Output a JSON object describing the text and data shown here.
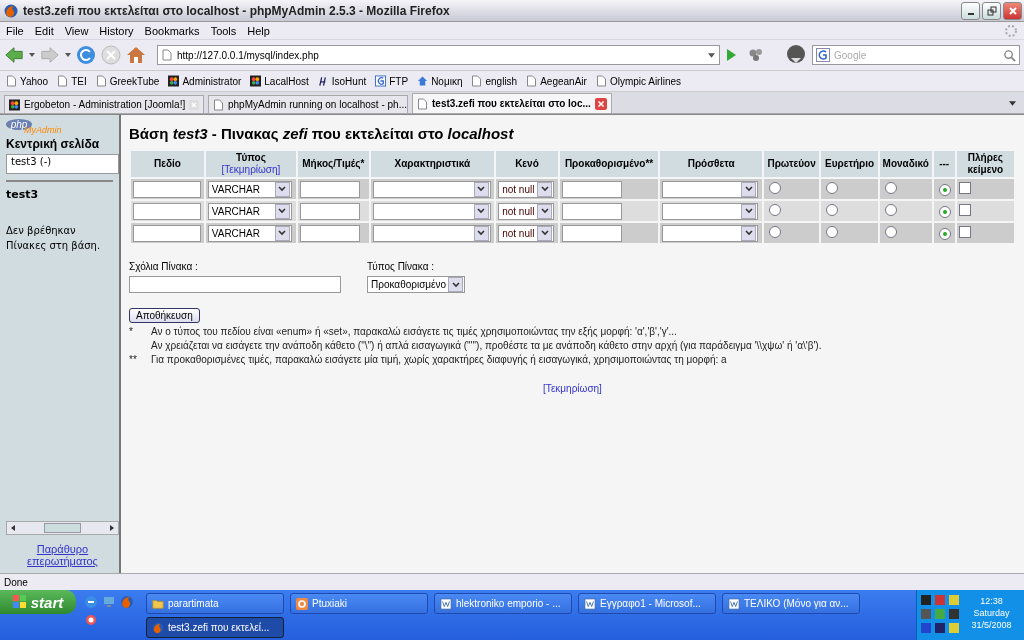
{
  "window": {
    "title": "test3.zefi που εκτελείται στο localhost - phpMyAdmin 2.5.3 - Mozilla Firefox"
  },
  "menu": [
    "File",
    "Edit",
    "View",
    "History",
    "Bookmarks",
    "Tools",
    "Help"
  ],
  "toolbar": {
    "url": "http://127.0.0.1/mysql/index.php",
    "search_placeholder": "Google"
  },
  "bookmarks": [
    {
      "label": "Yahoo",
      "kind": "page"
    },
    {
      "label": "TEI",
      "kind": "page"
    },
    {
      "label": "GreekTube",
      "kind": "page"
    },
    {
      "label": "Administrator",
      "kind": "joomla"
    },
    {
      "label": "LacalHost",
      "kind": "joomla"
    },
    {
      "label": "IsoHunt",
      "kind": "iso"
    },
    {
      "label": "FTP",
      "kind": "google"
    },
    {
      "label": "Νομικη",
      "kind": "house"
    },
    {
      "label": "english",
      "kind": "page"
    },
    {
      "label": "AegeanAir",
      "kind": "page"
    },
    {
      "label": "Olympic Airlines",
      "kind": "page"
    }
  ],
  "tabs": [
    {
      "label": "Ergobeton - Administration [Joomla!]",
      "selected": false,
      "kind": "joomla"
    },
    {
      "label": "phpMyAdmin running on localhost - ph...",
      "selected": false,
      "kind": "page"
    },
    {
      "label": "test3.zefi που εκτελείται στο loc...",
      "selected": true,
      "kind": "page"
    }
  ],
  "sidebar": {
    "logo_top": "php",
    "logo_bottom": "MyAdmin",
    "home": "Κεντρική σελίδα",
    "database_select": "test3 (-)",
    "database": "test3",
    "note": "Δεν βρέθηκαν Πίνακες στη βάση.",
    "query_window": "Παράθυρο επερωτήματος"
  },
  "main": {
    "heading": "Βάση *test3* - Πινακας *zefi* που εκτελείται στο *localhost*",
    "columns": [
      {
        "label": "Πεδίο"
      },
      {
        "label": "Τύπος",
        "link": "[Τεκμηρίωση]"
      },
      {
        "label": "Μήκος/Τιμές*"
      },
      {
        "label": "Χαρακτηριστικά"
      },
      {
        "label": "Κενό"
      },
      {
        "label": "Προκαθορισμένο**"
      },
      {
        "label": "Πρόσθετα"
      },
      {
        "label": "Πρωτεύον"
      },
      {
        "label": "Ευρετήριο"
      },
      {
        "label": "Μοναδικό"
      },
      {
        "label": "---"
      },
      {
        "label": "Πλήρες κείμενο"
      }
    ],
    "rows": [
      {
        "type": "VARCHAR",
        "null": "not null",
        "radios": [
          {
            "selected": false
          },
          {
            "selected": false
          },
          {
            "selected": false
          },
          {
            "selected": true
          }
        ],
        "fulltext_checked": false
      },
      {
        "type": "VARCHAR",
        "null": "not null",
        "radios": [
          {
            "selected": false
          },
          {
            "selected": false
          },
          {
            "selected": false
          },
          {
            "selected": true
          }
        ],
        "fulltext_checked": false
      },
      {
        "type": "VARCHAR",
        "null": "not null",
        "radios": [
          {
            "selected": false
          },
          {
            "selected": false
          },
          {
            "selected": false
          },
          {
            "selected": true
          }
        ],
        "fulltext_checked": false
      }
    ],
    "comment_label": "Σχόλια Πίνακα :",
    "table_type_label": "Τύπος Πίνακα :",
    "table_type": "Προκαθορισμένο",
    "save": "Αποθήκευση",
    "notes": [
      {
        "mark": "*",
        "lines": [
          "Αν ο τύπος του πεδίου είναι «enum» ή «set», παρακαλώ εισάγετε τις τιμές χρησιμοποιώντας την εξής μορφή: 'α','β','γ'...",
          "Αν χρειάζεται να εισάγετε την ανάποδη κάθετο (\"\\\") ή απλά εισαγωγικά (\"'\"), προθέστε τα με ανάποδη κάθετο στην αρχή (για παράδειγμα '\\\\χψω' ή 'α\\'β')."
        ]
      },
      {
        "mark": "**",
        "lines": [
          "Για προκαθορισμένες τιμές, παρακαλώ εισάγετε μία τιμή, χωρίς χαρακτήρες διαφυγής ή εισαγωγικά, χρησιμοποιώντας τη μορφή: a"
        ]
      }
    ],
    "doc_link": "[Τεκμηρίωση]"
  },
  "status_bar": "Done",
  "taskbar": {
    "start": "start",
    "tasks": [
      {
        "label": "parartimata",
        "kind": "folder",
        "selected": false
      },
      {
        "label": "Ptuxiaki",
        "kind": "office",
        "selected": false
      },
      {
        "label": "hlektroniko emporio - ...",
        "kind": "word",
        "selected": false
      },
      {
        "label": "Εγγραφο1 - Microsof...",
        "kind": "word",
        "selected": false
      },
      {
        "label": "ΤΕΛΙΚΟ (Μόνο για αν...",
        "kind": "word",
        "selected": false
      },
      {
        "label": "test3.zefi που εκτελεί...",
        "kind": "firefox",
        "selected": true
      }
    ],
    "time": "12:38",
    "day": "Saturday",
    "date": "31/5/2008"
  }
}
